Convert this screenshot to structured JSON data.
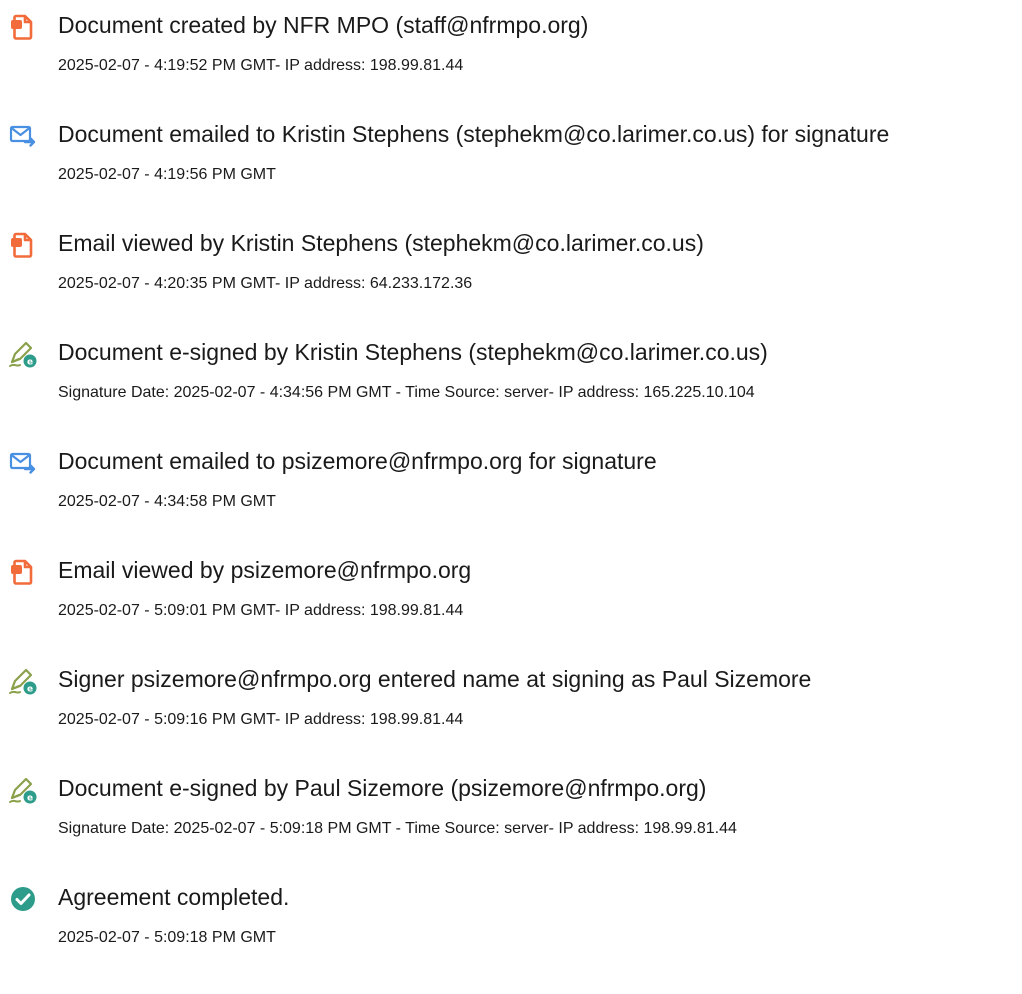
{
  "colors": {
    "doc_icon": "#f26b3a",
    "email_icon": "#4a90e2",
    "sign_icon_pen": "#8aa04a",
    "sign_icon_badge": "#2e9c8a",
    "complete_icon": "#2e9c8a"
  },
  "events": [
    {
      "icon": "document-icon",
      "title": "Document created by NFR MPO (staff@nfrmpo.org)",
      "detail": "2025-02-07 - 4:19:52 PM GMT- IP address: 198.99.81.44"
    },
    {
      "icon": "email-sent-icon",
      "title": "Document emailed to Kristin Stephens (stephekm@co.larimer.co.us) for signature",
      "detail": "2025-02-07 - 4:19:56 PM GMT"
    },
    {
      "icon": "document-icon",
      "title": "Email viewed by Kristin Stephens (stephekm@co.larimer.co.us)",
      "detail": "2025-02-07 - 4:20:35 PM GMT- IP address: 64.233.172.36"
    },
    {
      "icon": "esign-pen-icon",
      "title": "Document e-signed by Kristin Stephens (stephekm@co.larimer.co.us)",
      "detail": "Signature Date: 2025-02-07 - 4:34:56 PM GMT - Time Source: server- IP address: 165.225.10.104"
    },
    {
      "icon": "email-sent-icon",
      "title": "Document emailed to psizemore@nfrmpo.org for signature",
      "detail": "2025-02-07 - 4:34:58 PM GMT"
    },
    {
      "icon": "document-icon",
      "title": "Email viewed by psizemore@nfrmpo.org",
      "detail": "2025-02-07 - 5:09:01 PM GMT- IP address: 198.99.81.44"
    },
    {
      "icon": "esign-pen-icon",
      "title": "Signer psizemore@nfrmpo.org entered name at signing as Paul Sizemore",
      "detail": "2025-02-07 - 5:09:16 PM GMT- IP address: 198.99.81.44"
    },
    {
      "icon": "esign-pen-icon",
      "title": "Document e-signed by Paul Sizemore (psizemore@nfrmpo.org)",
      "detail": "Signature Date: 2025-02-07 - 5:09:18 PM GMT - Time Source: server- IP address: 198.99.81.44"
    },
    {
      "icon": "checkmark-circle-icon",
      "title": "Agreement completed.",
      "detail": "2025-02-07 - 5:09:18 PM GMT"
    }
  ]
}
